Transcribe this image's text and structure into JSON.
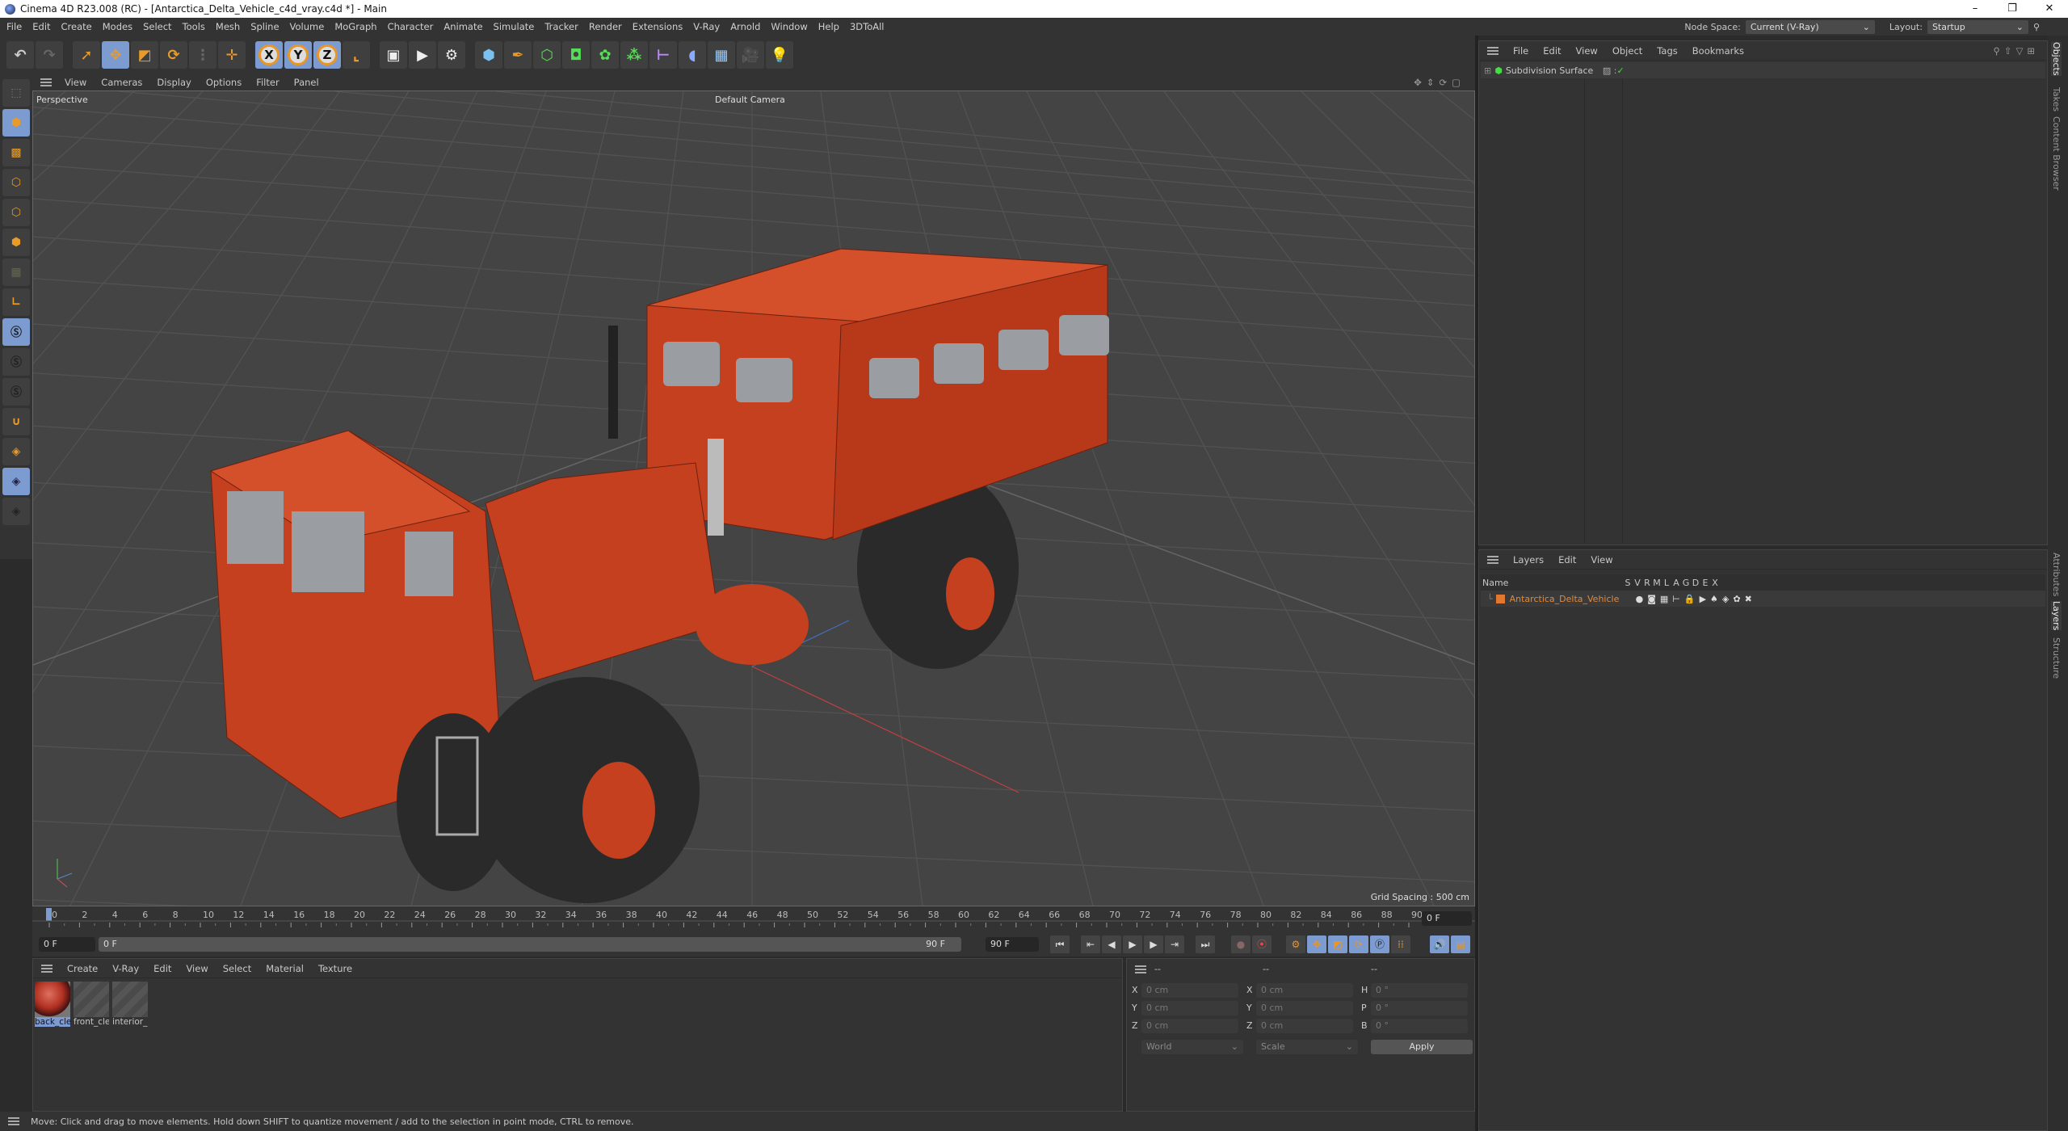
{
  "window": {
    "title": "Cinema 4D R23.008 (RC) - [Antarctica_Delta_Vehicle_c4d_vray.c4d *] - Main",
    "controls": [
      "–",
      "❐",
      "✕"
    ]
  },
  "menu": [
    "File",
    "Edit",
    "Create",
    "Modes",
    "Select",
    "Tools",
    "Mesh",
    "Spline",
    "Volume",
    "MoGraph",
    "Character",
    "Animate",
    "Simulate",
    "Tracker",
    "Render",
    "Extensions",
    "V-Ray",
    "Arnold",
    "Window",
    "Help",
    "3DToAll"
  ],
  "node_space": {
    "label": "Node Space:",
    "value": "Current (V-Ray)"
  },
  "layout": {
    "label": "Layout:",
    "value": "Startup"
  },
  "toolbar": {
    "axis": [
      "X",
      "Y",
      "Z"
    ]
  },
  "viewport": {
    "menu": [
      "View",
      "Cameras",
      "Display",
      "Options",
      "Filter",
      "Panel"
    ],
    "view_name": "Perspective",
    "camera": "Default Camera",
    "grid_spacing": "Grid Spacing : 500 cm",
    "colors": {
      "vehicle": "#c4401e",
      "tire": "#2a2a2a",
      "window": "#9a9ea2"
    }
  },
  "timeline": {
    "labels": [
      "0",
      "2",
      "4",
      "6",
      "8",
      "10",
      "12",
      "14",
      "16",
      "18",
      "20",
      "22",
      "24",
      "26",
      "28",
      "30",
      "32",
      "34",
      "36",
      "38",
      "40",
      "42",
      "44",
      "46",
      "48",
      "50",
      "52",
      "54",
      "56",
      "58",
      "60",
      "62",
      "64",
      "66",
      "68",
      "70",
      "72",
      "74",
      "76",
      "78",
      "80",
      "82",
      "84",
      "86",
      "88",
      "90"
    ],
    "current_frame": "0 F",
    "start": "0 F",
    "range_start": "0 F",
    "range_end": "90 F",
    "end": "90 F"
  },
  "materials": {
    "menu": [
      "Create",
      "V-Ray",
      "Edit",
      "View",
      "Select",
      "Material",
      "Texture"
    ],
    "items": [
      "back_cle",
      "front_cle",
      "interior_"
    ]
  },
  "coords": {
    "headers": [
      "--",
      "--",
      "--"
    ],
    "pos": [
      {
        "axis": "X",
        "value": "0 cm"
      },
      {
        "axis": "Y",
        "value": "0 cm"
      },
      {
        "axis": "Z",
        "value": "0 cm"
      }
    ],
    "size": [
      {
        "axis": "X",
        "value": "0 cm"
      },
      {
        "axis": "Y",
        "value": "0 cm"
      },
      {
        "axis": "Z",
        "value": "0 cm"
      }
    ],
    "rot": [
      {
        "axis": "H",
        "value": "0 °"
      },
      {
        "axis": "P",
        "value": "0 °"
      },
      {
        "axis": "B",
        "value": "0 °"
      }
    ],
    "space": "World",
    "mode": "Scale",
    "apply": "Apply"
  },
  "objects": {
    "menu": [
      "File",
      "Edit",
      "View",
      "Object",
      "Tags",
      "Bookmarks"
    ],
    "items": [
      {
        "name": "Subdivision Surface"
      }
    ]
  },
  "layers": {
    "menu": [
      "Layers",
      "Edit",
      "View"
    ],
    "columns": [
      "Name",
      "S",
      "V",
      "R",
      "M",
      "L",
      "A",
      "G",
      "D",
      "E",
      "X"
    ],
    "items": [
      {
        "name": "Antarctica_Delta_Vehicle",
        "color": "#e07830"
      }
    ]
  },
  "side_tabs": [
    "Objects",
    "Takes",
    "Content Browser",
    "Attributes",
    "Layers",
    "Structure"
  ],
  "status": "Move: Click and drag to move elements. Hold down SHIFT to quantize movement / add to the selection in point mode, CTRL to remove."
}
